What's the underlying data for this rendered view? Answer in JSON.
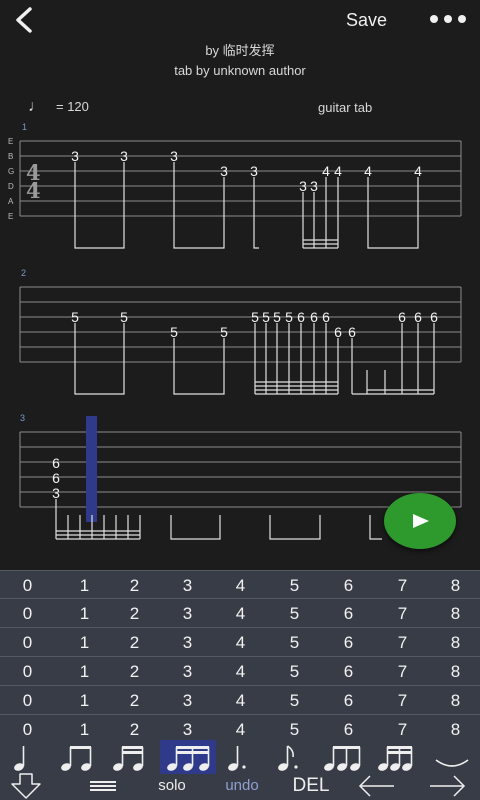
{
  "toolbar": {
    "save_label": "Save"
  },
  "header": {
    "author_line": "by 临时发挥",
    "tab_author_line": "tab by unknown author",
    "tempo_symbol": "♩",
    "tempo_text": "= 120",
    "tab_type": "guitar tab"
  },
  "staff": {
    "string_names": [
      "E",
      "B",
      "G",
      "D",
      "A",
      "E"
    ],
    "time_signature": [
      "4",
      "4"
    ],
    "measure_numbers": [
      "1",
      "2",
      "3"
    ],
    "measure1_frets": [
      "3",
      "3",
      "3",
      "3",
      "3",
      "3",
      "3",
      "4",
      "4",
      "4",
      "4"
    ],
    "measure2_frets": [
      "5",
      "5",
      "5",
      "5",
      "5",
      "5",
      "5",
      "5",
      "6",
      "6",
      "6",
      "6",
      "6",
      "6",
      "6",
      "6"
    ],
    "measure3_frets": [
      "6",
      "6",
      "3"
    ]
  },
  "keypad": {
    "rows": [
      [
        "0",
        "1",
        "2",
        "3",
        "4",
        "5",
        "6",
        "7",
        "8"
      ],
      [
        "0",
        "1",
        "2",
        "3",
        "4",
        "5",
        "6",
        "7",
        "8"
      ],
      [
        "0",
        "1",
        "2",
        "3",
        "4",
        "5",
        "6",
        "7",
        "8"
      ],
      [
        "0",
        "1",
        "2",
        "3",
        "4",
        "5",
        "6",
        "7",
        "8"
      ],
      [
        "0",
        "1",
        "2",
        "3",
        "4",
        "5",
        "6",
        "7",
        "8"
      ],
      [
        "0",
        "1",
        "2",
        "3",
        "4",
        "5",
        "6",
        "7",
        "8"
      ]
    ]
  },
  "note_values": [
    "quarter-note-icon",
    "two-eighths-icon",
    "two-sixteenths-icon",
    "four-sixteenths-icon",
    "dotted-quarter-icon",
    "dotted-eighth-icon",
    "triplet-eighths-icon",
    "sixteenth-group-icon",
    "tie-icon"
  ],
  "bottom": {
    "solo_label": "solo",
    "undo_label": "undo",
    "del_label": "DEL"
  },
  "colors": {
    "background": "#1c1c1c",
    "keypad_bg": "#383c46",
    "cursor": "#2f3a8a",
    "play": "#2e9a2e",
    "undo": "#8fa0d0"
  }
}
